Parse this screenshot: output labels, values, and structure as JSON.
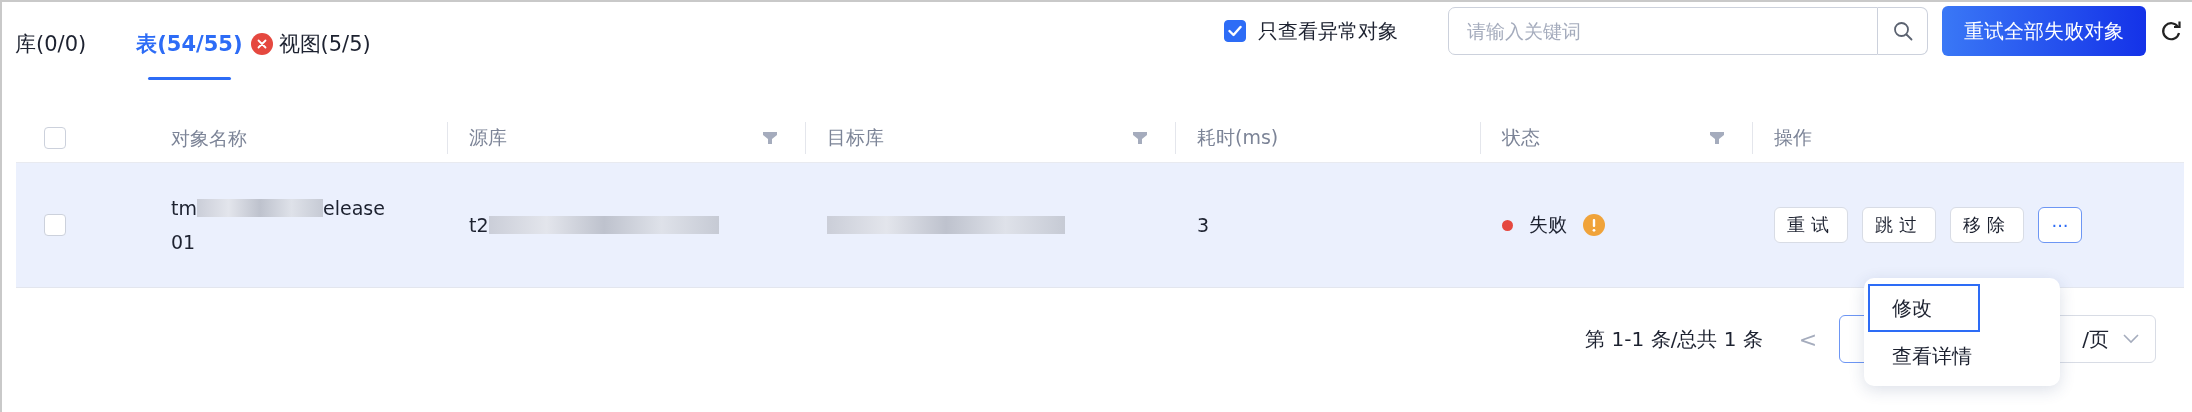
{
  "tabs": [
    {
      "label": "库(0/0)",
      "selected": false,
      "error": false
    },
    {
      "label": "表(54/55)",
      "selected": true,
      "error": true
    },
    {
      "label": "视图(5/5)",
      "selected": false,
      "error": false
    }
  ],
  "toolbar": {
    "abnormal_only": {
      "label": "只查看异常对象",
      "checked": true
    },
    "search": {
      "placeholder": "请输入关键词"
    },
    "retry_all_button": "重试全部失败对象"
  },
  "table": {
    "header_checked": false,
    "columns": [
      {
        "label": "对象名称",
        "filter": false
      },
      {
        "label": "源库",
        "filter": true
      },
      {
        "label": "目标库",
        "filter": true
      },
      {
        "label": "耗时(ms)",
        "filter": false
      },
      {
        "label": "状态",
        "filter": true
      },
      {
        "label": "操作",
        "filter": false
      }
    ],
    "rows": [
      {
        "checked": false,
        "selected": true,
        "name": {
          "start": "tm",
          "end": "elease",
          "line2": "01"
        },
        "source": {
          "start": "t2"
        },
        "target": {},
        "duration": "3",
        "status": {
          "label": "失败",
          "color": "#e5483f",
          "warning": true
        },
        "actions": [
          "重试",
          "跳过",
          "移除"
        ],
        "more": "···"
      }
    ]
  },
  "menu": {
    "items": [
      {
        "label": "修改",
        "selected": true
      },
      {
        "label": "查看详情",
        "selected": false
      }
    ]
  },
  "pagination": {
    "summary": "第 1-1 条/总共 1 条",
    "prev": "<",
    "page_size": "/页"
  }
}
